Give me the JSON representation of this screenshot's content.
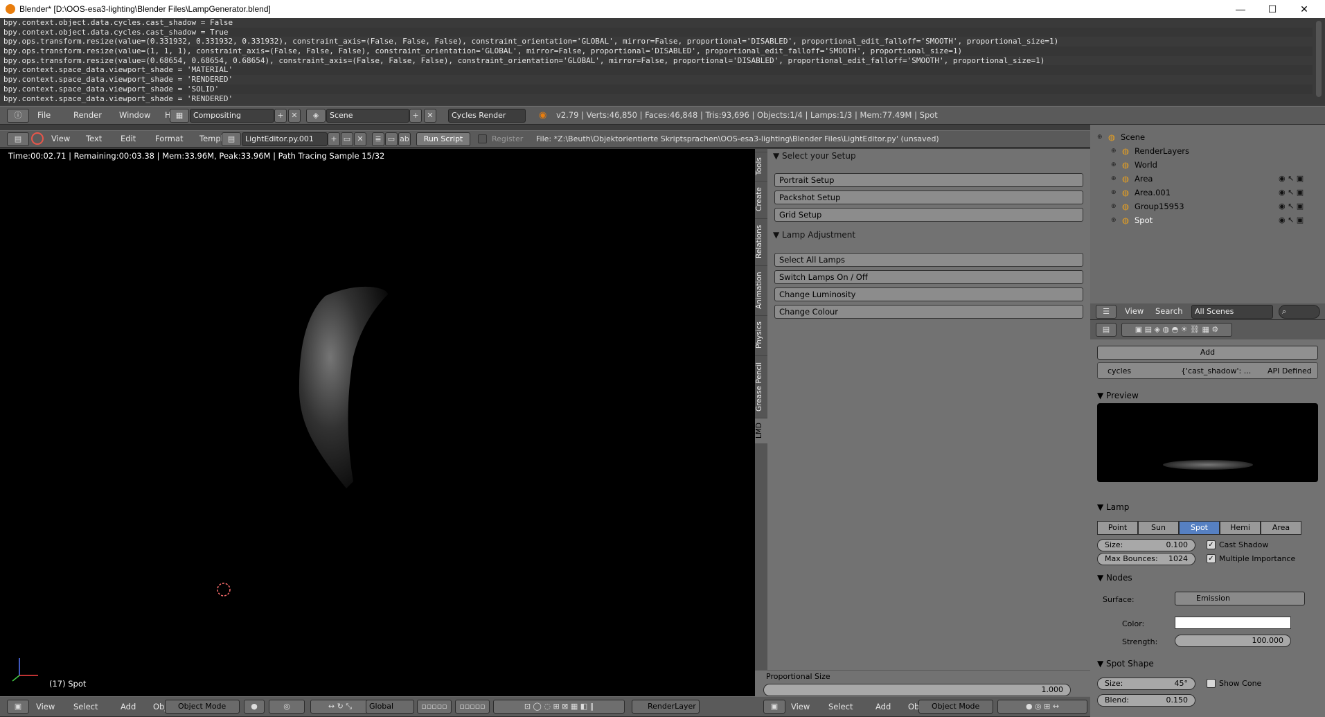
{
  "window": {
    "title": "Blender* [D:\\OOS-esa3-lighting\\Blender Files\\LampGenerator.blend]",
    "minimize": "—",
    "maximize": "☐",
    "close": "✕"
  },
  "console": {
    "lines": [
      "bpy.context.object.data.cycles.cast_shadow = False",
      "bpy.context.object.data.cycles.cast_shadow = True",
      "bpy.ops.transform.resize(value=(0.331932, 0.331932, 0.331932), constraint_axis=(False, False, False), constraint_orientation='GLOBAL', mirror=False, proportional='DISABLED', proportional_edit_falloff='SMOOTH', proportional_size=1)",
      "bpy.ops.transform.resize(value=(1, 1, 1), constraint_axis=(False, False, False), constraint_orientation='GLOBAL', mirror=False, proportional='DISABLED', proportional_edit_falloff='SMOOTH', proportional_size=1)",
      "bpy.ops.transform.resize(value=(0.68654, 0.68654, 0.68654), constraint_axis=(False, False, False), constraint_orientation='GLOBAL', mirror=False, proportional='DISABLED', proportional_edit_falloff='SMOOTH', proportional_size=1)",
      "bpy.context.space_data.viewport_shade = 'MATERIAL'",
      "bpy.context.space_data.viewport_shade = 'RENDERED'",
      "bpy.context.space_data.viewport_shade = 'SOLID'",
      "bpy.context.space_data.viewport_shade = 'RENDERED'"
    ]
  },
  "info": {
    "menus": [
      "File",
      "Render",
      "Window",
      "Help"
    ],
    "screen_layout": "Compositing",
    "scene": "Scene",
    "engine": "Cycles Render",
    "stats": "v2.79 | Verts:46,850 | Faces:46,848 | Tris:93,696 | Objects:1/4 | Lamps:1/3 | Mem:77.49M | Spot"
  },
  "text_editor": {
    "menus": [
      "View",
      "Text",
      "Edit",
      "Format",
      "Templates"
    ],
    "file_name": "LightEditor.py.001",
    "run_script": "Run Script",
    "register": "Register",
    "file_path": "File: *Z:\\Beuth\\Objektorientierte Skriptsprachen\\OOS-esa3-lighting\\Blender Files\\LightEditor.py' (unsaved)"
  },
  "viewport": {
    "render_stats": "Time:00:02.71 | Remaining:00:03.38 | Mem:33.96M, Peak:33.96M | Path Tracing Sample 15/32",
    "object_label": "(17) Spot",
    "footer_menus": [
      "View",
      "Select",
      "Add",
      "Object"
    ],
    "mode": "Object Mode",
    "orientation": "Global",
    "render_layer": "RenderLayer"
  },
  "tool_tabs": [
    "Tools",
    "Create",
    "Relations",
    "Animation",
    "Physics",
    "Grease Pencil",
    "LMD"
  ],
  "tool_panel": {
    "setup_header": "Select your Setup",
    "setup_buttons": [
      "Portrait Setup",
      "Packshot Setup",
      "Grid Setup"
    ],
    "lamp_header": "Lamp Adjustment",
    "lamp_buttons": [
      "Select All Lamps",
      "Switch Lamps On / Off",
      "Change Luminosity",
      "Change Colour"
    ],
    "proportional_label": "Proportional Size",
    "proportional_value": "1.000",
    "footer_menus": [
      "View",
      "Select",
      "Add",
      "Object"
    ],
    "mode": "Object Mode"
  },
  "outliner": {
    "items": [
      {
        "name": "Scene",
        "level": 0
      },
      {
        "name": "RenderLayers",
        "level": 1
      },
      {
        "name": "World",
        "level": 1
      },
      {
        "name": "Area",
        "level": 1
      },
      {
        "name": "Area.001",
        "level": 1
      },
      {
        "name": "Group15953",
        "level": 1
      },
      {
        "name": "Spot",
        "level": 1
      }
    ],
    "view": "View",
    "search": "Search",
    "filter": "All Scenes"
  },
  "properties": {
    "add_button": "Add",
    "prop_name": "cycles",
    "prop_value": "{'cast_shadow': ...",
    "prop_api": "API Defined",
    "preview_header": "Preview",
    "lamp_header": "Lamp",
    "lamp_types": [
      "Point",
      "Sun",
      "Spot",
      "Hemi",
      "Area"
    ],
    "active_lamp_type": "Spot",
    "size_label": "Size:",
    "size_value": "0.100",
    "bounces_label": "Max Bounces:",
    "bounces_value": "1024",
    "cast_shadow": "Cast Shadow",
    "multiple_importance": "Multiple Importance",
    "nodes_header": "Nodes",
    "surface_label": "Surface:",
    "surface_value": "Emission",
    "color_label": "Color:",
    "color_value": "#ffffff",
    "strength_label": "Strength:",
    "strength_value": "100.000",
    "spot_header": "Spot Shape",
    "spot_size_label": "Size:",
    "spot_size_value": "45°",
    "show_cone": "Show Cone",
    "blend_label": "Blend:",
    "blend_value": "0.150"
  }
}
